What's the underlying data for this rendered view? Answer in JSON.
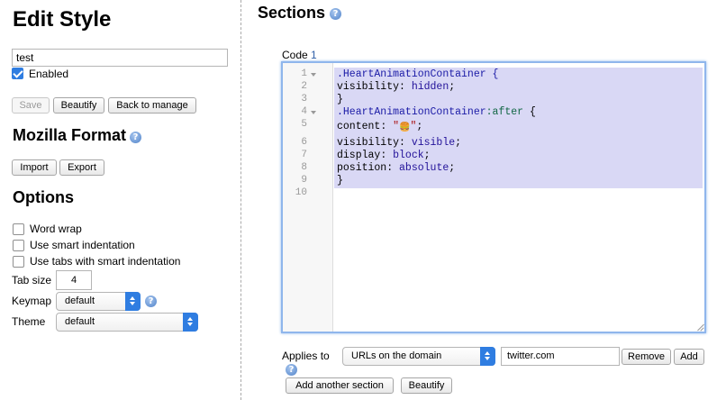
{
  "sidebar": {
    "title": "Edit Style",
    "name_value": "test",
    "enabled_label": "Enabled",
    "enabled_checked": true,
    "buttons": {
      "save": "Save",
      "beautify": "Beautify",
      "back": "Back to manage"
    },
    "mozilla": {
      "title": "Mozilla Format",
      "import": "Import",
      "export": "Export"
    },
    "options": {
      "title": "Options",
      "word_wrap": "Word wrap",
      "smart_indent": "Use smart indentation",
      "tabs_smart_indent": "Use tabs with smart indentation",
      "tab_size_label": "Tab size",
      "tab_size_value": "4",
      "keymap_label": "Keymap",
      "keymap_value": "default",
      "theme_label": "Theme",
      "theme_value": "default"
    }
  },
  "main": {
    "title": "Sections",
    "code_label": "Code",
    "code_index": "1",
    "line_numbers": [
      "1",
      "2",
      "3",
      "4",
      "5",
      "6",
      "7",
      "8",
      "9",
      "10"
    ],
    "code": {
      "l1": ".HeartAnimationContainer {",
      "l2_prop": "visibility",
      "l2_val": "hidden",
      "l3": "}",
      "l4_sel": ".HeartAnimationContainer",
      "l4_pseudo": ":after",
      "l4_brace": " {",
      "l5_prop": "content",
      "l5_q1": "\"",
      "l5_emoji": "🍔",
      "l5_q2": "\"",
      "l6_prop": "visibility",
      "l6_val": "visible",
      "l7_prop": "display",
      "l7_val": "block",
      "l8_prop": "position",
      "l8_val": "absolute",
      "l9": "}"
    },
    "applies_to_label": "Applies to",
    "applies_type": "URLs on the domain",
    "applies_value": "twitter.com",
    "remove": "Remove",
    "add": "Add",
    "add_section": "Add another section",
    "beautify": "Beautify"
  },
  "colors": {
    "accent": "#2f7de1",
    "selection": "#d9d8f5",
    "focus_ring": "#8fb6ec"
  }
}
